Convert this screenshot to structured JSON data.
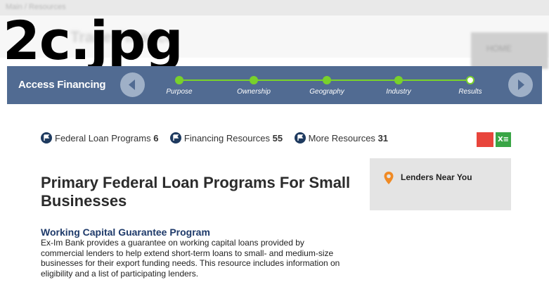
{
  "top_strip": {
    "breadcrumb": "Main / Resources"
  },
  "header": {
    "faded_text": "Trade Finance",
    "faded_button": "HOME"
  },
  "watermark": "2c.jpg",
  "progress": {
    "title": "Access Financing",
    "steps": [
      {
        "label": "Purpose",
        "state": "complete"
      },
      {
        "label": "Ownership",
        "state": "complete"
      },
      {
        "label": "Geography",
        "state": "complete"
      },
      {
        "label": "Industry",
        "state": "complete"
      },
      {
        "label": "Results",
        "state": "current"
      }
    ],
    "accent_color": "#79d12b",
    "bar_color": "#516b92"
  },
  "tabs": [
    {
      "label": "Federal Loan Programs",
      "count": "6",
      "icon": "flag-icon"
    },
    {
      "label": "Financing Resources",
      "count": "55",
      "icon": "flag-icon"
    },
    {
      "label": "More Resources",
      "count": "31",
      "icon": "flag-icon"
    }
  ],
  "export": {
    "pdf_color": "#e8453c",
    "xls_color": "#3aa546",
    "xls_icon": "X≡"
  },
  "main": {
    "title": "Primary Federal Loan Programs For Small Businesses",
    "program": {
      "title": "Working Capital Guarantee Program",
      "description": "Ex-Im Bank provides a guarantee on working capital loans provided by commercial lenders to help extend short-term loans to small- and medium-size businesses for their export funding needs. This resource includes information on eligibility and a list of participating lenders."
    }
  },
  "sidebar": {
    "lenders_label": "Lenders Near You",
    "pin_color": "#f08a24"
  }
}
